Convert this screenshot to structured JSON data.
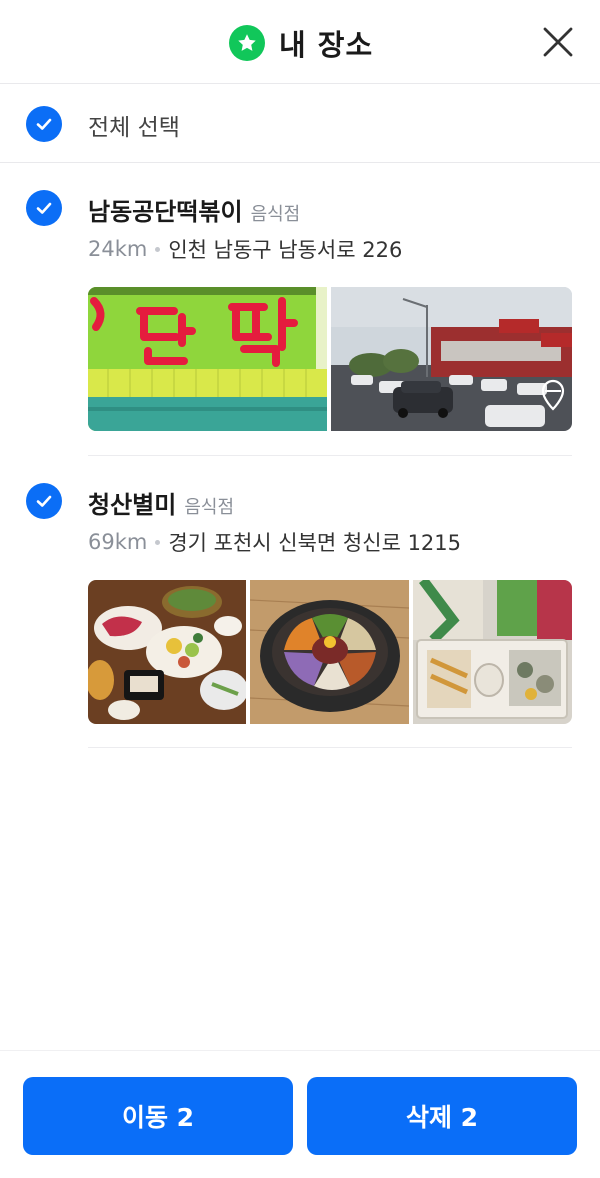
{
  "header": {
    "title": "내 장소",
    "star_color": "#11c75a"
  },
  "select_all": {
    "label": "전체 선택",
    "checked": true
  },
  "places": [
    {
      "name": "남동공단떡볶이",
      "category": "음식점",
      "distance": "24km",
      "address": "인천 남동구 남동서로 226",
      "checked": true,
      "photos": [
        "sign-photo",
        "street-view-photo"
      ]
    },
    {
      "name": "청산별미",
      "category": "음식점",
      "distance": "69km",
      "address": "경기 포천시 신북면 청신로 1215",
      "checked": true,
      "photos": [
        "table-spread-photo",
        "bibimbap-photo",
        "packaged-food-photo"
      ]
    }
  ],
  "actions": {
    "move_label": "이동 2",
    "delete_label": "삭제 2",
    "accent": "#0a6ef8"
  }
}
